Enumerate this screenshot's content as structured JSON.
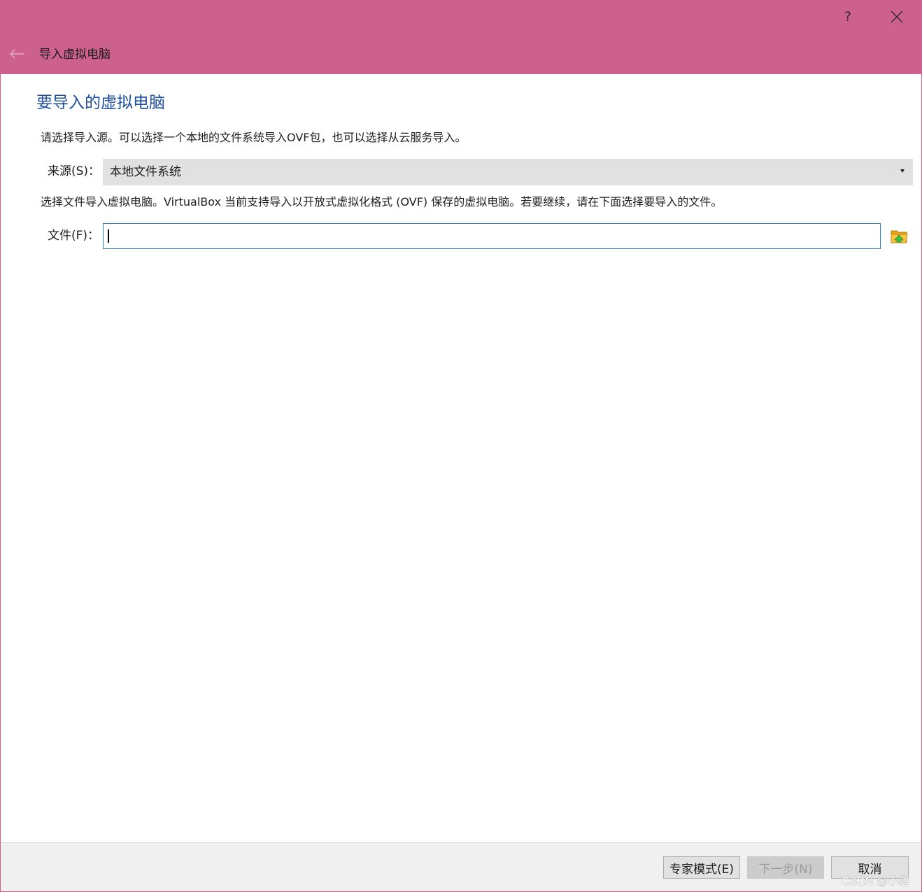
{
  "window": {
    "title": "导入虚拟电脑",
    "help_label": "?",
    "accent_color": "#cd618e"
  },
  "page": {
    "heading": "要导入的虚拟电脑",
    "description_source": "请选择导入源。可以选择一个本地的文件系统导入OVF包，也可以选择从云服务导入。",
    "source_label": "来源(S)：",
    "source_value": "本地文件系统",
    "description_file": "选择文件导入虚拟电脑。VirtualBox 当前支持导入以开放式虚拟化格式 (OVF) 保存的虚拟电脑。若要继续，请在下面选择要导入的文件。",
    "file_label": "文件(F)：",
    "file_value": ""
  },
  "footer": {
    "expert_label": "专家模式(E)",
    "next_label": "下一步(N)",
    "cancel_label": "取消",
    "watermark": "CSDN @小匣"
  },
  "icons": {
    "back": "back-arrow-icon",
    "help": "help-icon",
    "close": "close-icon",
    "folder": "folder-open-icon",
    "dropdown": "dropdown-arrow-icon"
  }
}
